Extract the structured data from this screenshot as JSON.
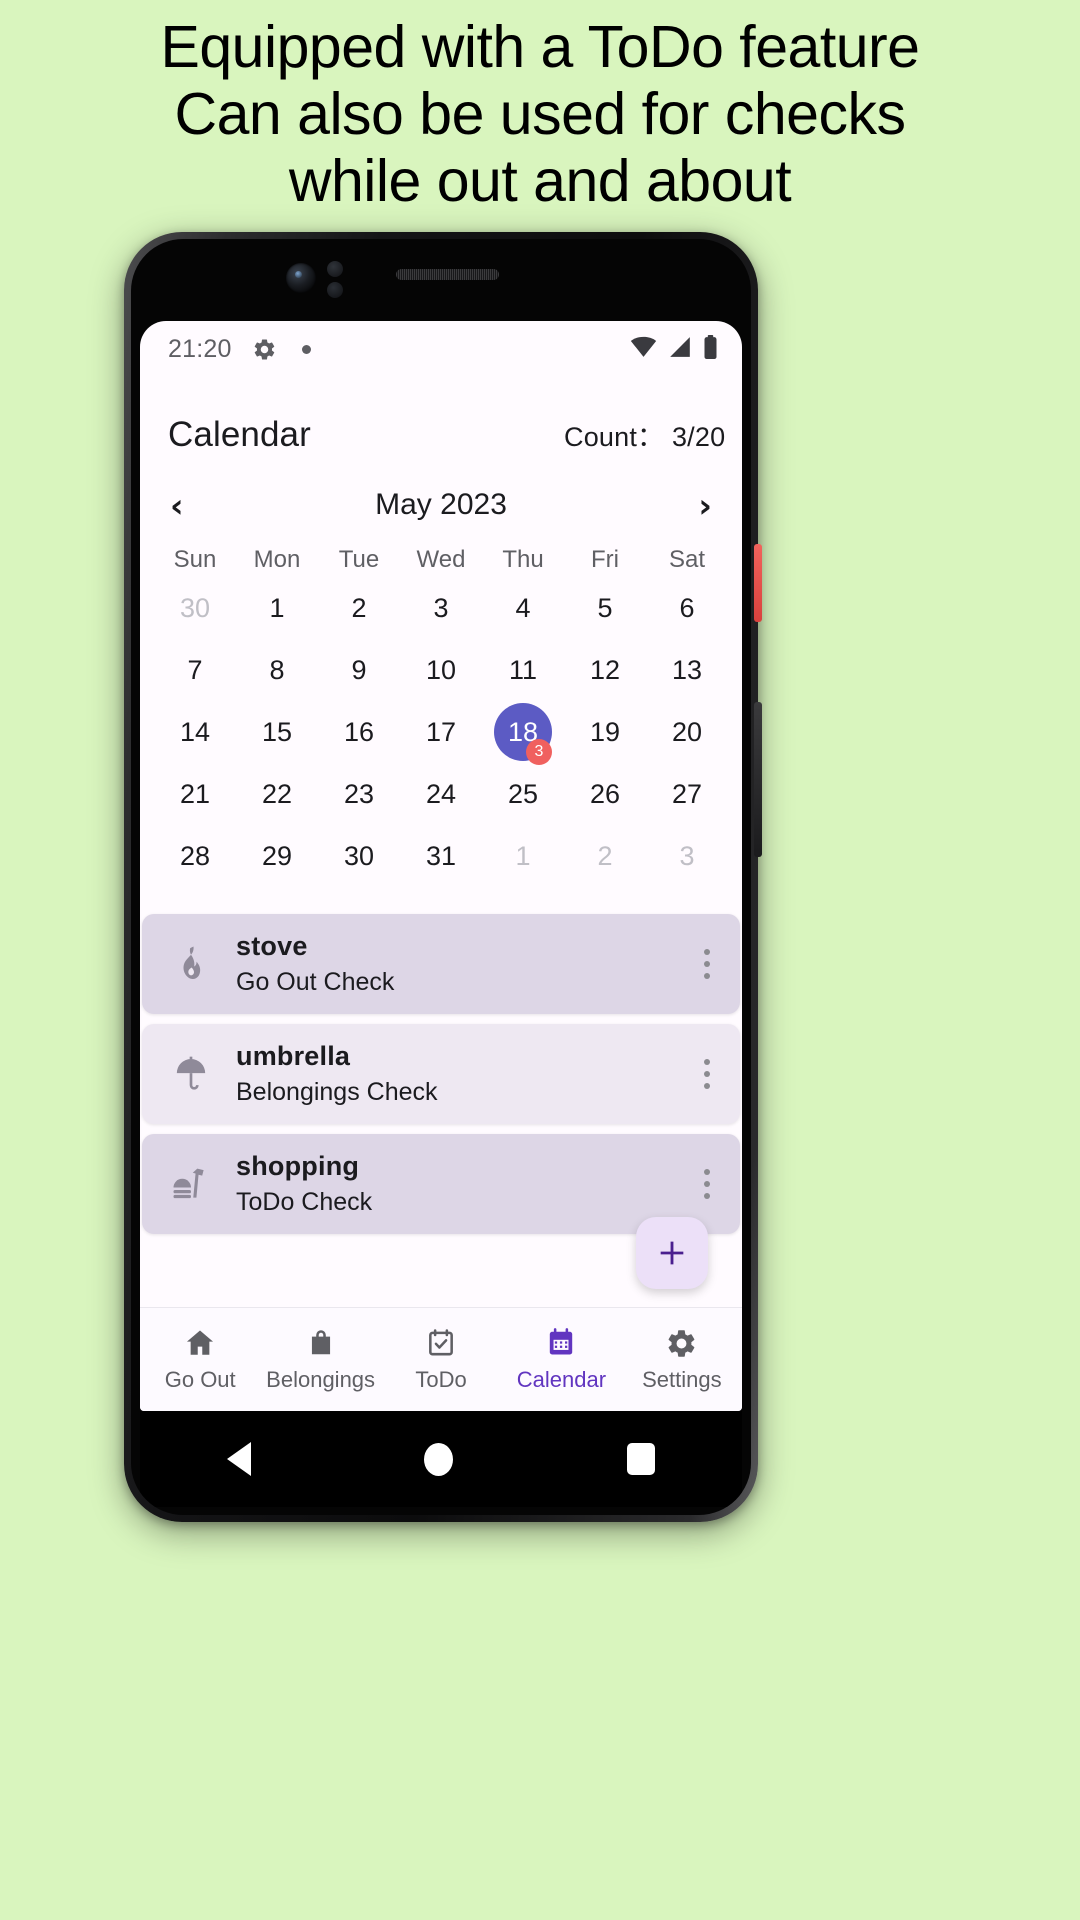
{
  "headline": {
    "line1": "Equipped with a ToDo feature",
    "line2": "Can also be used for checks",
    "line3": "while out and about"
  },
  "status_bar": {
    "time": "21:20",
    "icons": [
      "gear-icon",
      "dot-icon",
      "wifi-icon",
      "cellular-signal-icon",
      "battery-icon"
    ]
  },
  "app_bar": {
    "title": "Calendar",
    "count_label": "Count： 3/20"
  },
  "calendar": {
    "prev_label": "‹",
    "next_label": "›",
    "month_label": "May 2023",
    "weekdays": [
      "Sun",
      "Mon",
      "Tue",
      "Wed",
      "Thu",
      "Fri",
      "Sat"
    ],
    "selected_day": 18,
    "selected_badge": "3",
    "weeks": [
      [
        {
          "d": "30",
          "muted": true
        },
        {
          "d": "1"
        },
        {
          "d": "2"
        },
        {
          "d": "3"
        },
        {
          "d": "4"
        },
        {
          "d": "5"
        },
        {
          "d": "6"
        }
      ],
      [
        {
          "d": "7"
        },
        {
          "d": "8"
        },
        {
          "d": "9"
        },
        {
          "d": "10"
        },
        {
          "d": "11"
        },
        {
          "d": "12"
        },
        {
          "d": "13"
        }
      ],
      [
        {
          "d": "14"
        },
        {
          "d": "15"
        },
        {
          "d": "16"
        },
        {
          "d": "17"
        },
        {
          "d": "18",
          "selected": true,
          "badge": "3"
        },
        {
          "d": "19"
        },
        {
          "d": "20"
        }
      ],
      [
        {
          "d": "21"
        },
        {
          "d": "22"
        },
        {
          "d": "23"
        },
        {
          "d": "24"
        },
        {
          "d": "25"
        },
        {
          "d": "26"
        },
        {
          "d": "27"
        }
      ],
      [
        {
          "d": "28"
        },
        {
          "d": "29"
        },
        {
          "d": "30"
        },
        {
          "d": "31"
        },
        {
          "d": "1",
          "muted": true
        },
        {
          "d": "2",
          "muted": true
        },
        {
          "d": "3",
          "muted": true
        }
      ]
    ]
  },
  "events": [
    {
      "icon": "fire-icon",
      "title": "stove",
      "subtitle": "Go Out Check",
      "tint": "tint-a"
    },
    {
      "icon": "umbrella-icon",
      "title": "umbrella",
      "subtitle": "Belongings Check",
      "tint": "tint-b"
    },
    {
      "icon": "takeout-food-icon",
      "title": "shopping",
      "subtitle": "ToDo Check",
      "tint": "tint-a"
    }
  ],
  "fab": {
    "icon": "plus-icon",
    "label": "+"
  },
  "bottom_nav": {
    "items": [
      {
        "label": "Go Out",
        "icon": "home-icon",
        "active": false
      },
      {
        "label": "Belongings",
        "icon": "bag-icon",
        "active": false
      },
      {
        "label": "ToDo",
        "icon": "checklist-icon",
        "active": false
      },
      {
        "label": "Calendar",
        "icon": "calendar-icon",
        "active": true
      },
      {
        "label": "Settings",
        "icon": "gear-icon",
        "active": false
      }
    ]
  },
  "android_nav": {
    "back": "back-triangle-icon",
    "home": "home-circle-icon",
    "recents": "recents-square-icon"
  },
  "colors": {
    "page_background": "#d9f5be",
    "accent": "#6135c0",
    "selected_day": "#5c5bc4",
    "badge": "#f0605f",
    "card_tint_a": "#ddd6e6",
    "card_tint_b": "#eee8f2",
    "fab": "#ece0f8"
  }
}
